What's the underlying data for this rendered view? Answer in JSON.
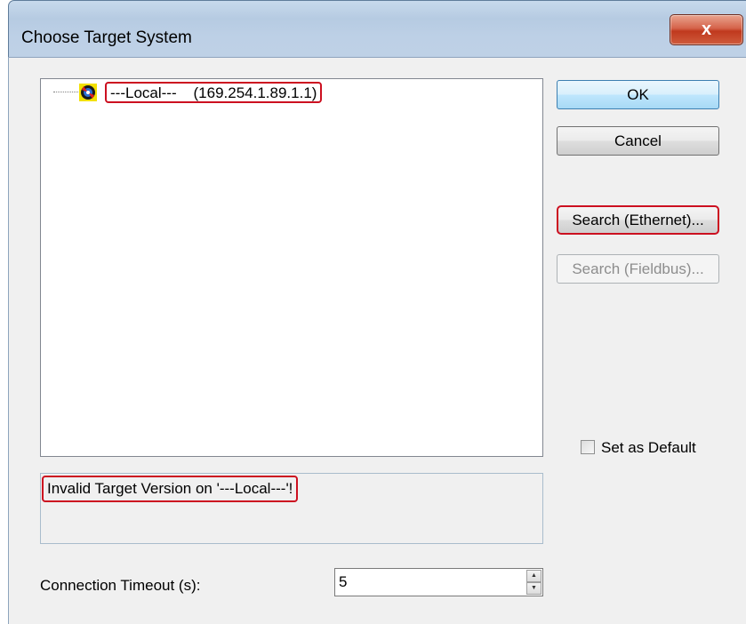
{
  "window": {
    "title": "Choose Target System",
    "close_label": "x"
  },
  "tree": {
    "items": [
      {
        "label": "---Local---    (169.254.1.89.1.1)",
        "icon": "target-system-icon"
      }
    ]
  },
  "buttons": {
    "ok": "OK",
    "cancel": "Cancel",
    "search_ethernet": "Search (Ethernet)...",
    "search_fieldbus": "Search (Fieldbus)..."
  },
  "checkbox": {
    "label": "Set as Default",
    "checked": false
  },
  "status": {
    "message": "Invalid Target Version on '---Local---'!"
  },
  "timeout": {
    "label": "Connection Timeout (s):",
    "value": "5"
  },
  "colors": {
    "highlight_outline": "#cc1020",
    "ok_button_border": "#3c7fb1",
    "close_button": "#c0391e"
  }
}
